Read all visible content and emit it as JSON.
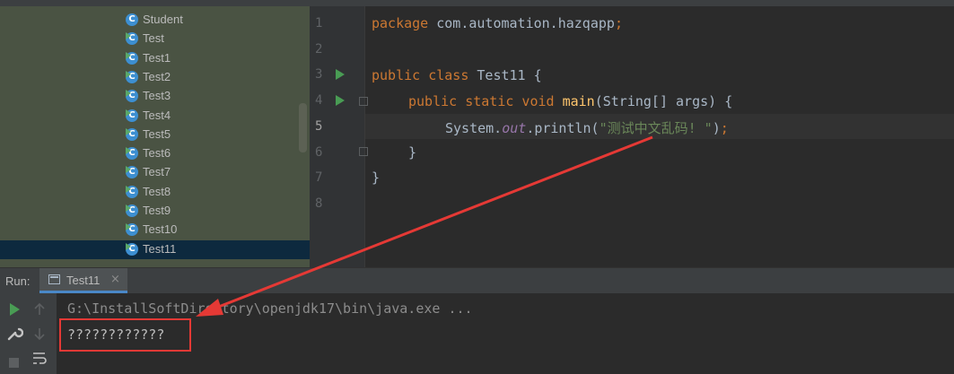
{
  "project_tree": {
    "items": [
      {
        "label": "Student",
        "selected": false,
        "runnable": false
      },
      {
        "label": "Test",
        "selected": false,
        "runnable": true
      },
      {
        "label": "Test1",
        "selected": false,
        "runnable": true
      },
      {
        "label": "Test2",
        "selected": false,
        "runnable": true
      },
      {
        "label": "Test3",
        "selected": false,
        "runnable": true
      },
      {
        "label": "Test4",
        "selected": false,
        "runnable": true
      },
      {
        "label": "Test5",
        "selected": false,
        "runnable": true
      },
      {
        "label": "Test6",
        "selected": false,
        "runnable": true
      },
      {
        "label": "Test7",
        "selected": false,
        "runnable": true
      },
      {
        "label": "Test8",
        "selected": false,
        "runnable": true
      },
      {
        "label": "Test9",
        "selected": false,
        "runnable": true
      },
      {
        "label": "Test10",
        "selected": false,
        "runnable": true
      },
      {
        "label": "Test11",
        "selected": true,
        "runnable": true
      }
    ],
    "class_icon_letter": "C"
  },
  "editor": {
    "line_numbers": [
      "1",
      "2",
      "3",
      "4",
      "5",
      "6",
      "7",
      "8"
    ],
    "current_line": "5",
    "code": {
      "line1_kw": "package",
      "line1_rest": " com.automation.hazqapp",
      "line1_semi": ";",
      "line3_kw": "public class",
      "line3_rest": " Test11 {",
      "line4_kw": "public static void",
      "line4_fn": "main",
      "line4_rest": "(String[] args) {",
      "line5_obj": "System.",
      "line5_field": "out",
      "line5_call": ".println(",
      "line5_string": "\"测试中文乱码! \"",
      "line5_close": ")",
      "line5_semi": ";",
      "line6": "}",
      "line7": "}"
    }
  },
  "run_panel": {
    "label": "Run:",
    "tab_label": "Test11",
    "tab_close": "×",
    "console_lines": [
      "G:\\InstallSoftDirectory\\openjdk17\\bin\\java.exe ...",
      "????????????"
    ]
  },
  "colors": {
    "annotation": "#e53935",
    "tree_bg": "#4a5343",
    "selected_row": "#0d293e",
    "run_green": "#499c54"
  },
  "icons": {
    "tree_class": "class-icon",
    "gutter_run": "run-gutter-icon",
    "toolbar": [
      "rerun-icon",
      "up-arrow-icon",
      "wrench-icon",
      "down-arrow-icon",
      "stop-icon",
      "soft-wrap-icon"
    ]
  }
}
